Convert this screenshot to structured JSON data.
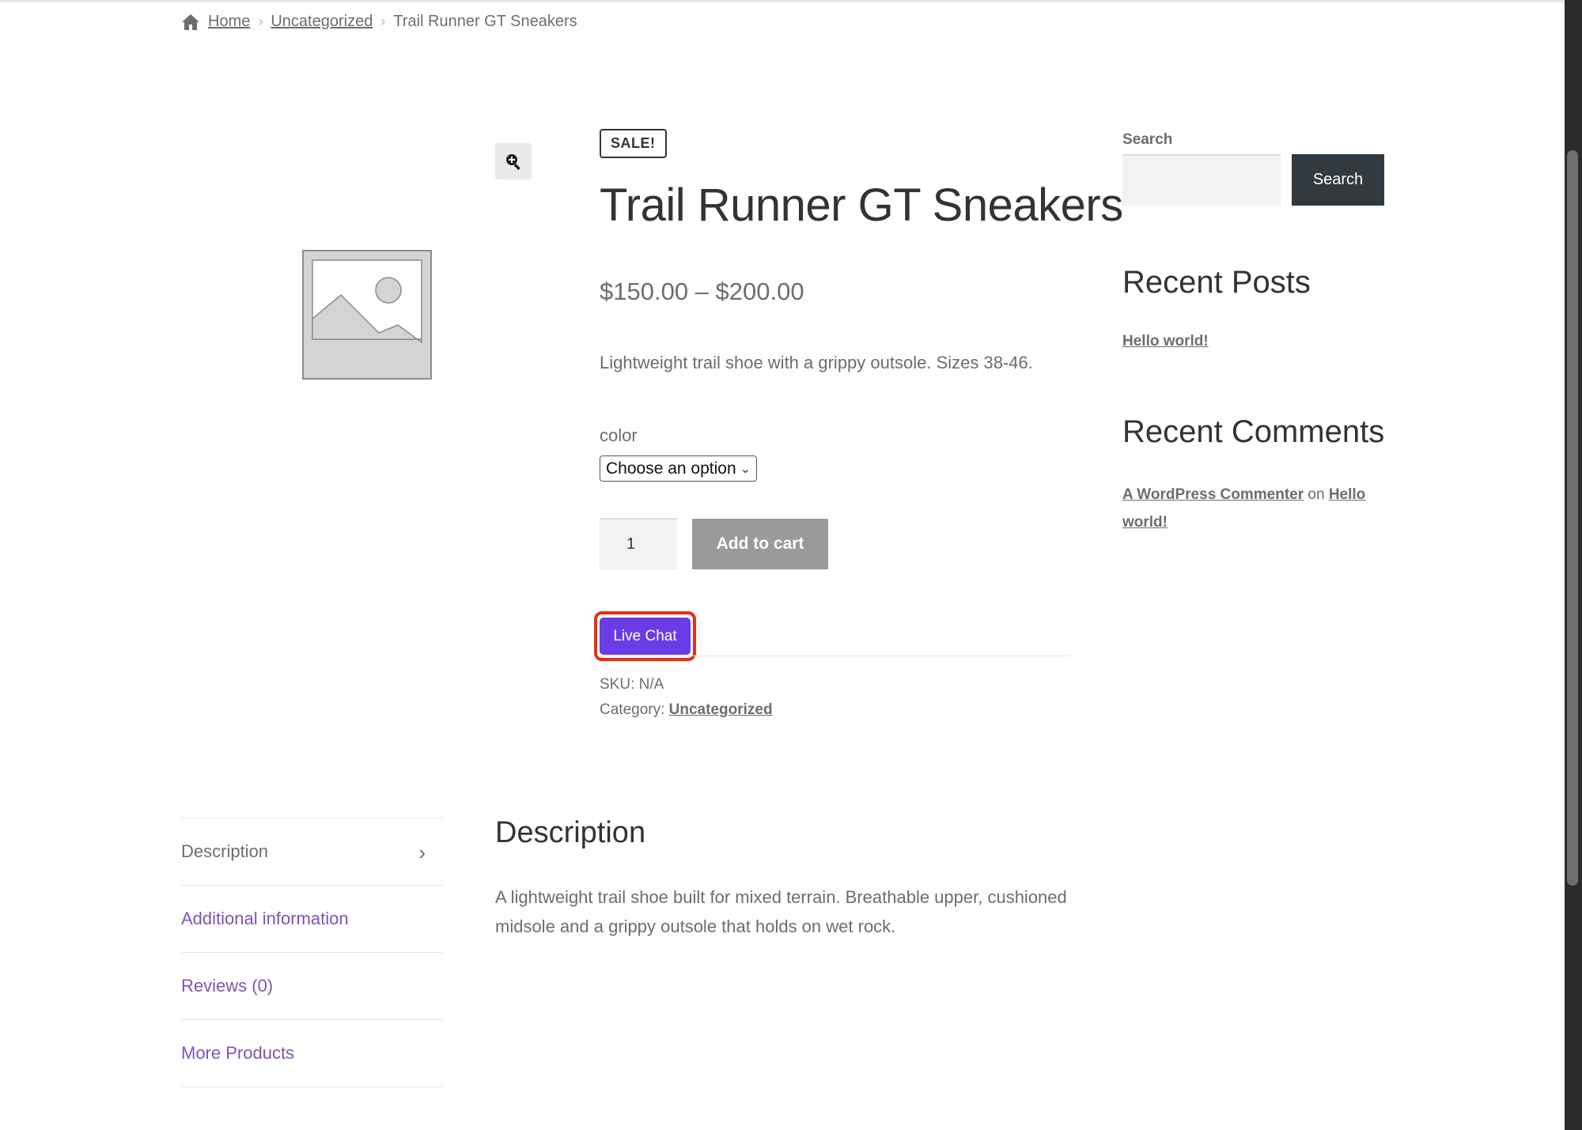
{
  "breadcrumb": {
    "home": "Home",
    "category": "Uncategorized",
    "current": "Trail Runner GT Sneakers"
  },
  "product": {
    "sale_badge": "SALE!",
    "title": "Trail Runner GT Sneakers",
    "price": "$150.00 – $200.00",
    "short_description": "Lightweight trail shoe with a grippy outsole. Sizes 38-46.",
    "attribute_label": "color",
    "attribute_selected": "Choose an option",
    "quantity": "1",
    "add_to_cart_label": "Add to cart",
    "live_chat_label": "Live Chat",
    "sku_label": "SKU:",
    "sku_value": "N/A",
    "category_label": "Category:",
    "category_value": "Uncategorized"
  },
  "sidebar": {
    "search_label": "Search",
    "search_button": "Search",
    "recent_posts_heading": "Recent Posts",
    "recent_post": "Hello world!",
    "recent_comments_heading": "Recent Comments",
    "comment_author": "A WordPress Commenter",
    "comment_on": "on",
    "comment_post": "Hello world!"
  },
  "tabs": [
    {
      "label": "Description"
    },
    {
      "label": "Additional information"
    },
    {
      "label": "Reviews (0)"
    },
    {
      "label": "More Products"
    }
  ],
  "description": {
    "heading": "Description",
    "body": "A lightweight trail shoe built for mixed terrain. Breathable upper, cushioned midsole and a grippy outsole that holds on wet rock."
  },
  "colors": {
    "live_chat_bg": "#6a3ce6",
    "live_chat_highlight": "#e33014",
    "tab_link": "#7f54b3",
    "search_button_bg": "#333a3f",
    "add_to_cart_bg": "#9a9a9a"
  },
  "icons": {
    "home": "home-icon",
    "zoom": "zoom-in-icon",
    "placeholder": "image-placeholder-icon",
    "select_chevron": "chevron-down-icon",
    "tab_chevron": "chevron-right-icon"
  }
}
